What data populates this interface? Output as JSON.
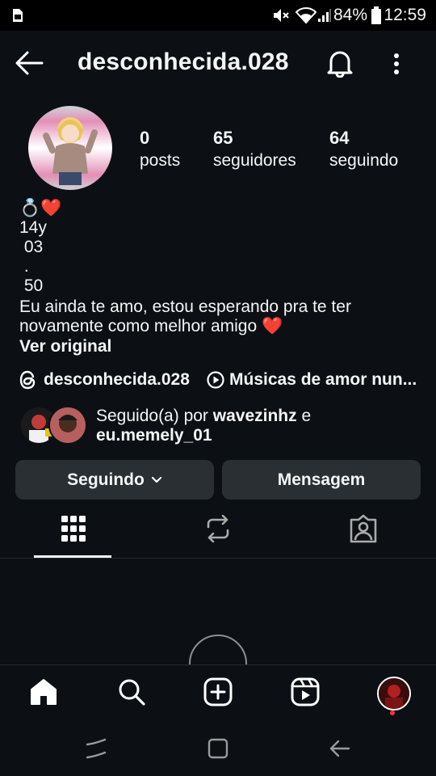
{
  "status_bar": {
    "battery_percent": "84%",
    "time": "12:59"
  },
  "header": {
    "username": "desconhecida.028"
  },
  "stats": {
    "posts_count": "0",
    "posts_label": "posts",
    "followers_count": "65",
    "followers_label": "seguidores",
    "following_count": "64",
    "following_label": "seguindo"
  },
  "bio": {
    "emoji_line": "💍❤️",
    "line2": "14y",
    "line3": " 03",
    "line4": " .",
    "line5": " 50",
    "line6": "Eu ainda te amo, estou esperando pra te ter",
    "line7": "novamente como melhor amigo ❤️",
    "see_translation": "Ver original"
  },
  "links": {
    "threads_username": "desconhecida.028",
    "music": "Músicas de amor nun..."
  },
  "followed_by": {
    "prefix": "Seguido(a) por ",
    "user1": "wavezinhz",
    "joiner": " e",
    "user2": "eu.memely_01"
  },
  "actions": {
    "following_label": "Seguindo",
    "message_label": "Mensagem"
  },
  "colors": {
    "background": "#0c1014",
    "button": "#2a2f33",
    "notification_dot": "#ff3040"
  }
}
